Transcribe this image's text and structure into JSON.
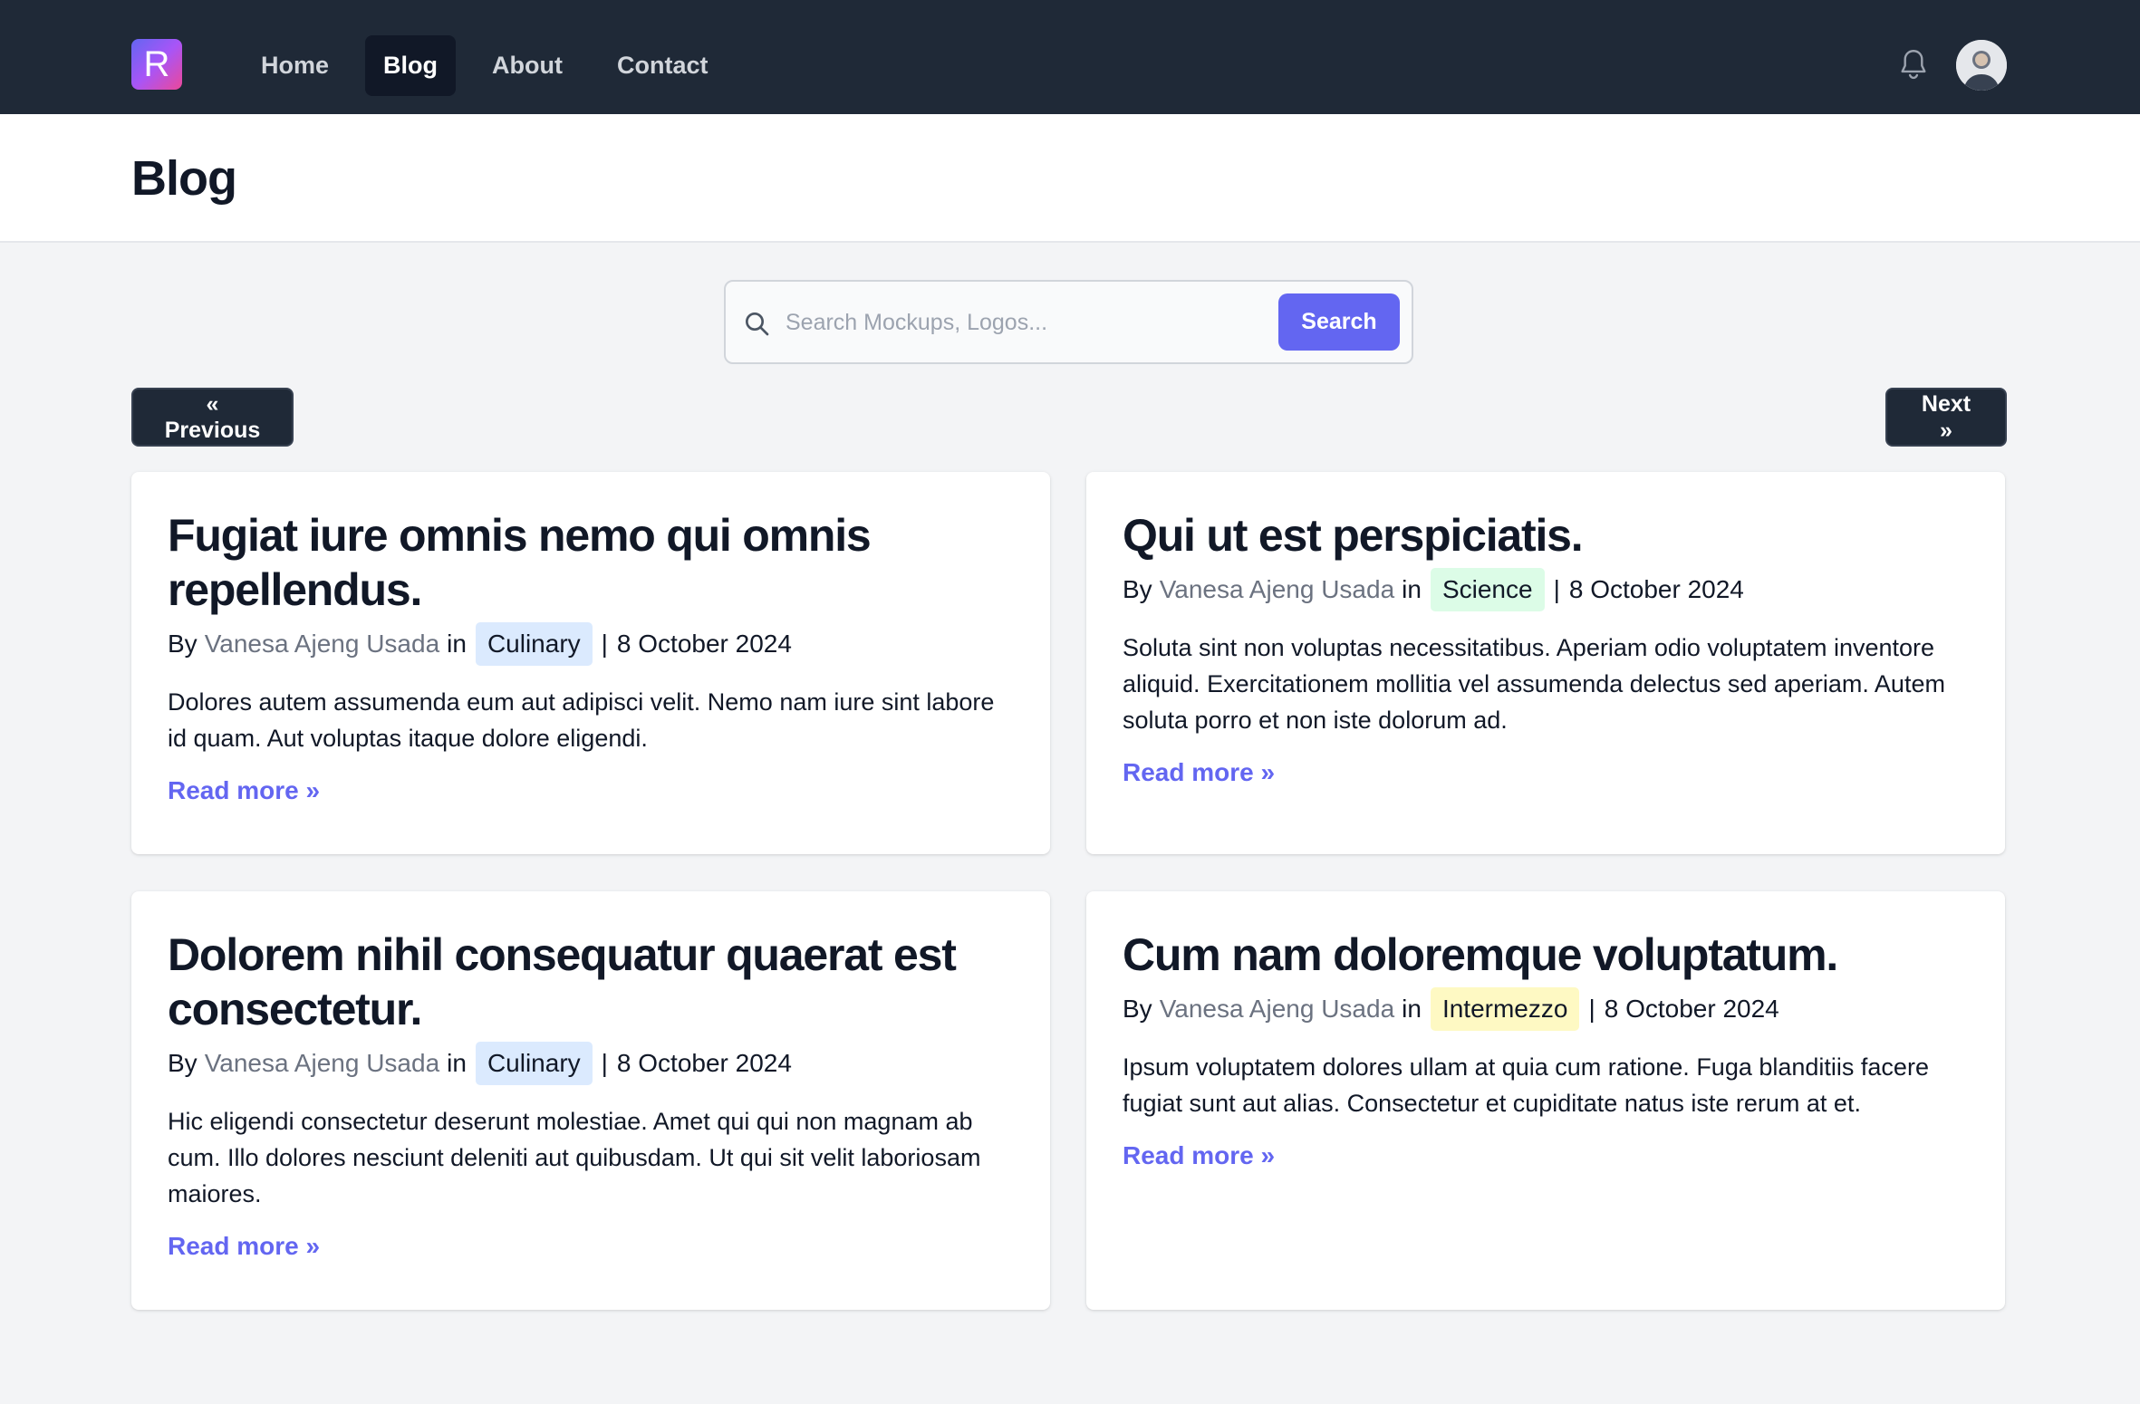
{
  "nav": {
    "logo_letter": "R",
    "links": [
      {
        "label": "Home"
      },
      {
        "label": "Blog"
      },
      {
        "label": "About"
      },
      {
        "label": "Contact"
      }
    ]
  },
  "header": {
    "title": "Blog"
  },
  "search": {
    "placeholder": "Search Mockups, Logos...",
    "button_label": "Search"
  },
  "pagination": {
    "previous_label": "« Previous",
    "next_label": "Next »"
  },
  "posts": [
    {
      "title": "Fugiat iure omnis nemo qui omnis repellendus.",
      "by": "By",
      "author": "Vanesa Ajeng Usada",
      "in": "in",
      "category": "Culinary",
      "date": "8 October 2024",
      "excerpt": "Dolores autem assumenda eum aut adipisci velit. Nemo nam iure sint labore id quam. Aut voluptas itaque dolore eligendi.",
      "read_more": "Read more »"
    },
    {
      "title": "Qui ut est perspiciatis.",
      "by": "By",
      "author": "Vanesa Ajeng Usada",
      "in": "in",
      "category": "Science",
      "date": "8 October 2024",
      "excerpt": "Soluta sint non voluptas necessitatibus. Aperiam odio voluptatem inventore aliquid. Exercitationem mollitia vel assumenda delectus sed aperiam. Autem soluta porro et non iste dolorum ad.",
      "read_more": "Read more »"
    },
    {
      "title": "Dolorem nihil consequatur quaerat est consectetur.",
      "by": "By",
      "author": "Vanesa Ajeng Usada",
      "in": "in",
      "category": "Culinary",
      "date": "8 October 2024",
      "excerpt": "Hic eligendi consectetur deserunt molestiae. Amet qui qui non magnam ab cum. Illo dolores nesciunt deleniti aut quibusdam. Ut qui sit velit laboriosam maiores.",
      "read_more": "Read more »"
    },
    {
      "title": "Cum nam doloremque voluptatum.",
      "by": "By",
      "author": "Vanesa Ajeng Usada",
      "in": "in",
      "category": "Intermezzo",
      "date": "8 October 2024",
      "excerpt": "Ipsum voluptatem dolores ullam at quia cum ratione. Fuga blanditiis facere fugiat sunt aut alias. Consectetur et cupiditate natus iste rerum at et.",
      "read_more": "Read more »"
    }
  ],
  "colors": {
    "nav_bg": "#1f2937",
    "accent": "#6366f1",
    "culinary_tag": "#dbeafe",
    "science_tag": "#dcfce7",
    "intermezzo_tag": "#fef9c3"
  },
  "icons": {
    "bell": "bell-icon",
    "search": "search-icon",
    "avatar": "user-avatar"
  }
}
